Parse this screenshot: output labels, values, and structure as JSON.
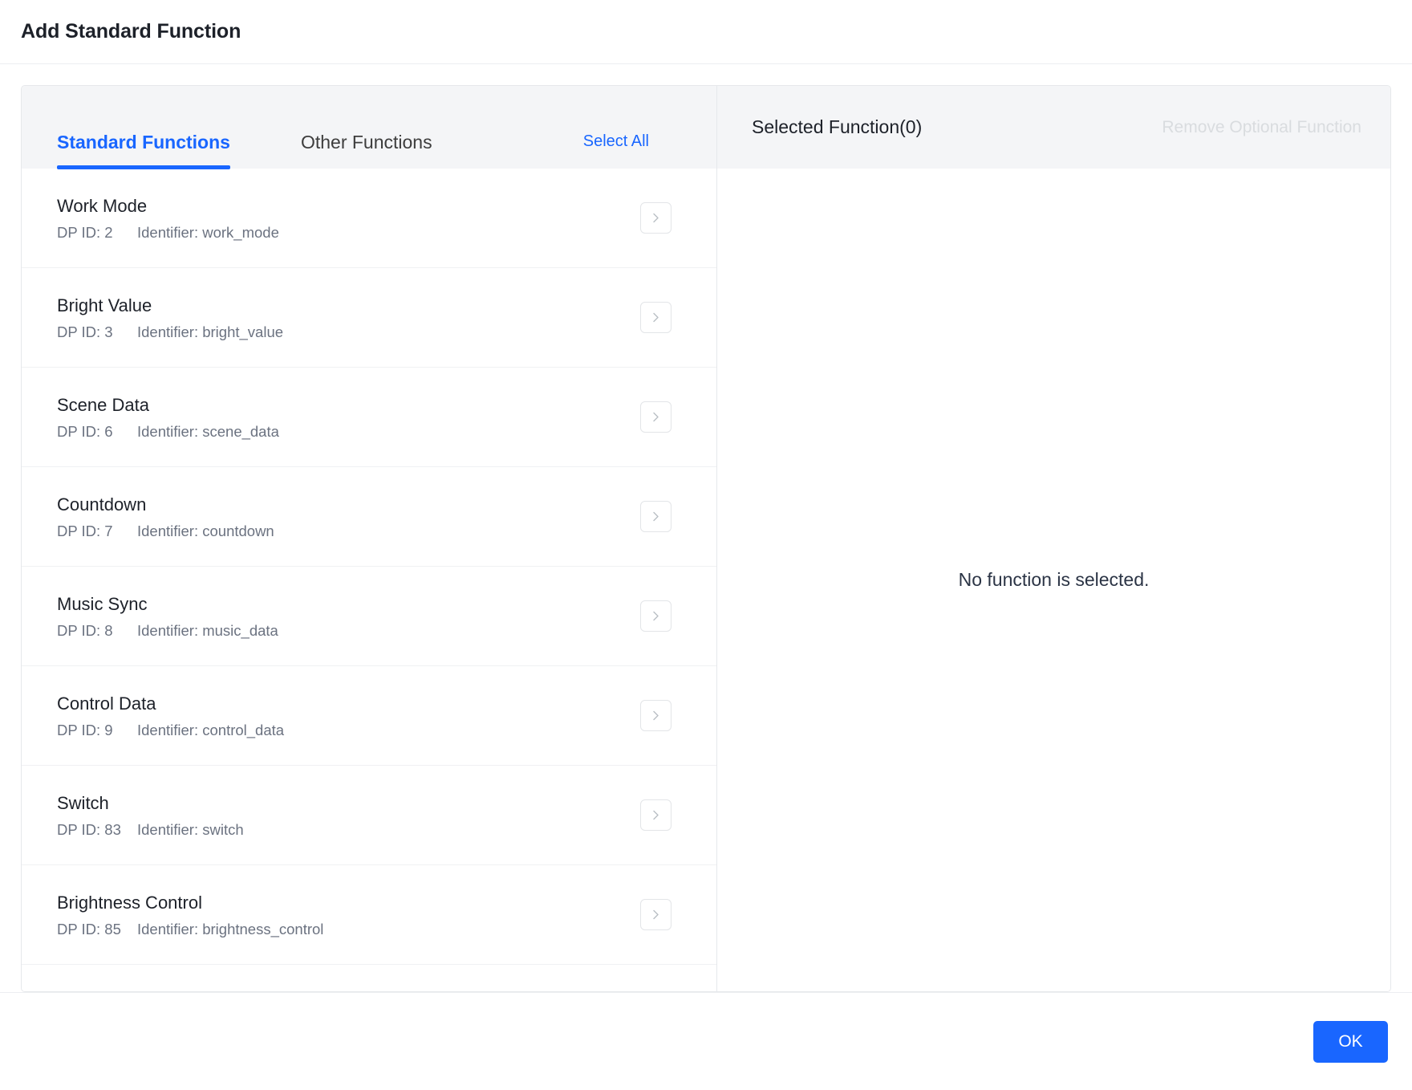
{
  "header": {
    "title": "Add Standard Function"
  },
  "left_panel": {
    "tabs": [
      {
        "label": "Standard Functions",
        "active": true
      },
      {
        "label": "Other Functions",
        "active": false
      }
    ],
    "select_all_label": "Select All",
    "dp_id_prefix": "DP ID:",
    "identifier_prefix": "Identifier:",
    "functions": [
      {
        "name": "Work Mode",
        "dp_id": "DP ID: 2",
        "identifier": "Identifier: work_mode"
      },
      {
        "name": "Bright Value",
        "dp_id": "DP ID: 3",
        "identifier": "Identifier: bright_value"
      },
      {
        "name": "Scene Data",
        "dp_id": "DP ID: 6",
        "identifier": "Identifier: scene_data"
      },
      {
        "name": "Countdown",
        "dp_id": "DP ID: 7",
        "identifier": "Identifier: countdown"
      },
      {
        "name": "Music Sync",
        "dp_id": "DP ID: 8",
        "identifier": "Identifier: music_data"
      },
      {
        "name": "Control Data",
        "dp_id": "DP ID: 9",
        "identifier": "Identifier: control_data"
      },
      {
        "name": "Switch",
        "dp_id": "DP ID: 83",
        "identifier": "Identifier: switch"
      },
      {
        "name": "Brightness Control",
        "dp_id": "DP ID: 85",
        "identifier": "Identifier: brightness_control"
      }
    ]
  },
  "right_panel": {
    "title": "Selected Function(0)",
    "remove_optional_label": "Remove Optional Function",
    "empty_message": "No function is selected."
  },
  "footer": {
    "ok_label": "OK"
  },
  "icons": {
    "row_arrow": "chevron-right-icon"
  },
  "colors": {
    "accent": "#1966ff",
    "tab_active": "#1966ff",
    "link": "#1966ff",
    "disabled_text": "#d9dcdf",
    "primary_text": "#1d2129",
    "secondary_text": "#6b7280",
    "panel_header_bg": "#f4f5f7",
    "border": "#e6e8eb"
  }
}
